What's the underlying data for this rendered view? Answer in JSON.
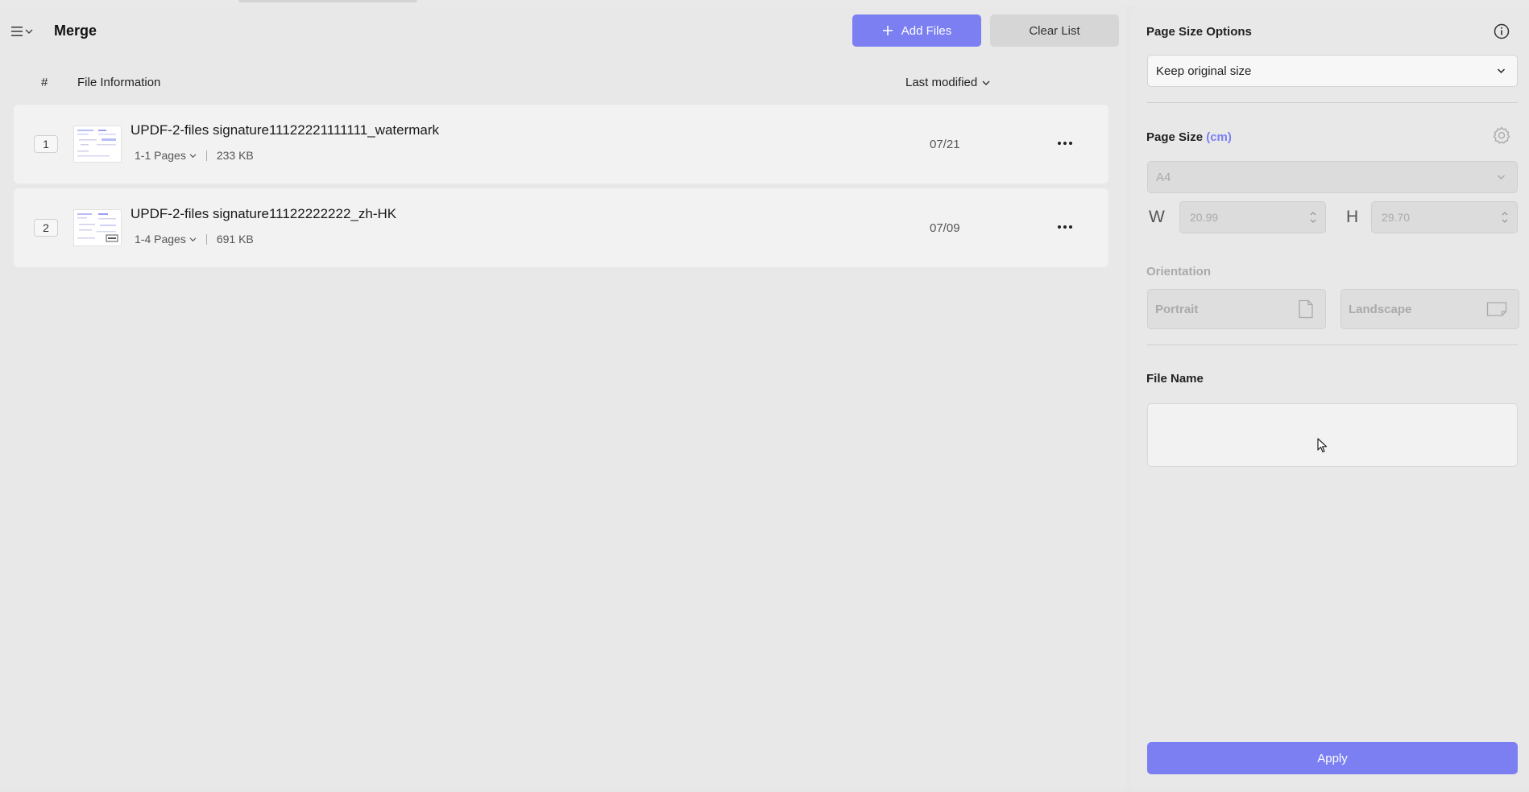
{
  "header": {
    "title": "Merge",
    "add_files_label": "Add Files",
    "clear_list_label": "Clear List"
  },
  "table": {
    "col_number": "#",
    "col_info": "File Information",
    "col_sort": "Last modified"
  },
  "files": [
    {
      "index": "1",
      "name": "UPDF-2-files signature11122221111111_watermark",
      "pages": "1-1 Pages",
      "size": "233 KB",
      "date": "07/21"
    },
    {
      "index": "2",
      "name": "UPDF-2-files signature11122222222_zh-HK",
      "pages": "1-4 Pages",
      "size": "691 KB",
      "date": "07/09"
    }
  ],
  "sidebar": {
    "page_size_options_label": "Page Size Options",
    "page_size_option_value": "Keep original size",
    "page_size_label": "Page Size",
    "page_size_unit": "(cm)",
    "paper_value": "A4",
    "width_label": "W",
    "width_value": "20.99",
    "height_label": "H",
    "height_value": "29.70",
    "orientation_label": "Orientation",
    "portrait_label": "Portrait",
    "landscape_label": "Landscape",
    "file_name_label": "File Name",
    "file_name_value": "",
    "apply_label": "Apply"
  },
  "colors": {
    "accent": "#7b7ff2",
    "background": "#e8e8e8",
    "row": "#f2f2f2"
  },
  "icons": [
    "menu-icon",
    "chevron-down-icon",
    "plus-icon",
    "info-icon",
    "gear-icon",
    "spinner-arrows-icon",
    "portrait-page-icon",
    "landscape-page-icon",
    "more-dots-icon"
  ]
}
